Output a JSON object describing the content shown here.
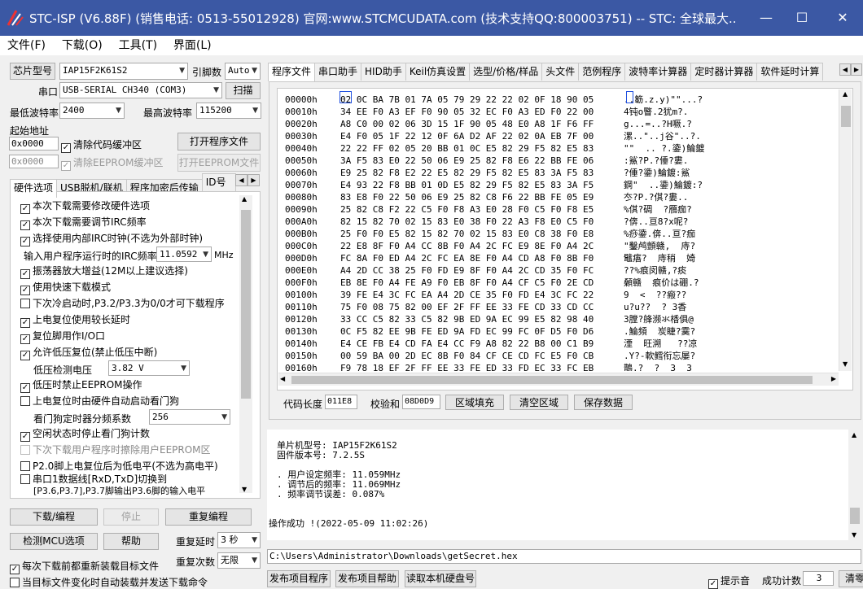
{
  "window": {
    "title": "STC-ISP (V6.88F) (销售电话: 0513-55012928) 官网:www.STCMCUDATA.com (技术支持QQ:800003751) -- STC: 全球最大...",
    "min_glyph": "—",
    "max_glyph": "☐",
    "close_glyph": "✕"
  },
  "menu": [
    "文件(F)",
    "下载(O)",
    "工具(T)",
    "界面(L)"
  ],
  "left": {
    "chip_btn": "芯片型号",
    "chip_value": "IAP15F2K61S2",
    "pins_label": "引脚数",
    "pins_value": "Auto",
    "port_label": "串口",
    "port_value": "USB-SERIAL CH340 (COM3)",
    "scan_btn": "扫描",
    "min_baud_label": "最低波特率",
    "min_baud_value": "2400",
    "max_baud_label": "最高波特率",
    "max_baud_value": "115200",
    "start_addr_label": "起始地址",
    "addr1_value": "0x0000",
    "clear_code_label": "清除代码缓冲区",
    "open_prog_btn": "打开程序文件",
    "addr2_value": "0x0000",
    "clear_eeprom_label": "清除EEPROM缓冲区",
    "open_eeprom_btn": "打开EEPROM文件",
    "tabs": [
      "硬件选项",
      "USB脱机/联机",
      "程序加密后传输",
      "ID号"
    ],
    "hw_options": [
      {
        "label": "本次下载需要修改硬件选项",
        "checked": true
      },
      {
        "label": "本次下载需要调节IRC频率",
        "checked": true
      },
      {
        "label": "选择使用内部IRC时钟(不选为外部时钟)",
        "checked": true
      },
      {
        "label": "振荡器放大增益(12M以上建议选择)",
        "checked": true
      },
      {
        "label": "使用快速下载模式",
        "checked": true
      },
      {
        "label": "下次冷启动时,P3.2/P3.3为0/0才可下载程序",
        "checked": false
      },
      {
        "label": "上电复位使用较长延时",
        "checked": true
      },
      {
        "label": "复位脚用作I/O口",
        "checked": true
      },
      {
        "label": "允许低压复位(禁止低压中断)",
        "checked": true
      },
      {
        "label": "低压时禁止EEPROM操作",
        "checked": true
      },
      {
        "label": "上电复位时由硬件自动启动看门狗",
        "checked": false
      },
      {
        "label": "空闲状态时停止看门狗计数",
        "checked": true
      },
      {
        "label": "下次下载用户程序时擦除用户EEPROM区",
        "checked": false
      },
      {
        "label": "P2.0脚上电复位后为低电平(不选为高电平)",
        "checked": false
      },
      {
        "label": "串口1数据线[RxD,TxD]切换到",
        "checked": false
      }
    ],
    "irc_freq_label": "输入用户程序运行时的IRC频率",
    "irc_freq_value": "11.0592",
    "irc_unit": "MHz",
    "lv_label": "低压检测电压",
    "lv_value": "3.82 V",
    "wdt_label": "看门狗定时器分频系数",
    "wdt_value": "256",
    "uart_line2": "[P3.6,P3.7],P3.7脚输出P3.6脚的输入电平",
    "download_btn": "下载/编程",
    "stop_btn": "停止",
    "reprogram_btn": "重复编程",
    "detect_btn": "检测MCU选项",
    "help_btn": "帮助",
    "repeat_delay_label": "重复延时",
    "repeat_delay_value": "3 秒",
    "reload_label": "每次下载前都重新装载目标文件",
    "reload_checked": true,
    "repeat_count_label": "重复次数",
    "repeat_count_value": "无限",
    "auto_label": "当目标文件变化时自动装载并发送下载命令",
    "auto_checked": false
  },
  "right": {
    "tabs": [
      "程序文件",
      "串口助手",
      "HID助手",
      "Keil仿真设置",
      "选型/价格/样品",
      "头文件",
      "范例程序",
      "波特率计算器",
      "定时器计算器",
      "软件延时计算"
    ],
    "hex_rows": [
      {
        "addr": "00000h",
        "hex": "02 0C BA 7B 01 7A 05 79 29 22 22 02 0F 18 90 05",
        "ascii": "..簕.z.y)\"\"...?"
      },
      {
        "addr": "00010h",
        "hex": "34 EE F0 A3 EF F0 90 05 32 EC F0 A3 ED F0 22 00",
        "ascii": "4钝o睯.2犹m?."
      },
      {
        "addr": "00020h",
        "hex": "A8 C0 00 02 06 3D 15 1F 90 05 48 E0 A8 1F F6 FF",
        "ascii": "g...=..?H噘.?"
      },
      {
        "addr": "00030h",
        "hex": "E4 F0 05 1F 22 12 0F 6A D2 AF 22 02 0A EB 7F 00",
        "ascii": "漯..\"..j谷\"..?."
      },
      {
        "addr": "00040h",
        "hex": "22 22 FF 02 05 20 BB 01 0C E5 82 29 F5 82 E5 83",
        "ascii": "\"\"  .. ?.鍌)鯩鍍"
      },
      {
        "addr": "00050h",
        "hex": "3A F5 83 E0 22 50 06 E9 25 82 F8 E6 22 BB FE 06",
        "ascii": ":鯊?P.?倕?婁."
      },
      {
        "addr": "00060h",
        "hex": "E9 25 82 F8 E2 22 E5 82 29 F5 82 E5 83 3A F5 83",
        "ascii": "?倕?鍌)鯩鍍:鯊"
      },
      {
        "addr": "00070h",
        "hex": "E4 93 22 F8 BB 01 0D E5 82 29 F5 82 E5 83 3A F5",
        "ascii": "鋼\"  ..鍌)鯩鍍:?"
      },
      {
        "addr": "00080h",
        "hex": "83 E8 F0 22 50 06 E9 25 82 C8 F6 22 BB FE 05 E9",
        "ascii": "冭?P.?倛?婁.."
      },
      {
        "addr": "00090h",
        "hex": "25 82 C8 F2 22 C5 F0 F8 A3 E0 28 F0 C5 F0 F8 E5",
        "ascii": "%倛?碉  ?鴈痂?"
      },
      {
        "addr": "000A0h",
        "hex": "82 15 82 70 02 15 83 E0 38 F0 22 A3 F8 E0 C5 F0",
        "ascii": "?倴..亘8?x呢?"
      },
      {
        "addr": "000B0h",
        "hex": "25 F0 F0 E5 82 15 82 70 02 15 83 E0 C8 38 F0 E8",
        "ascii": "%痧鍌.倴..亘?痂"
      },
      {
        "addr": "000C0h",
        "hex": "22 E8 8F F0 A4 CC 8B F0 A4 2C FC E9 8E F0 A4 2C",
        "ascii": "\"鑿鸬顫赣,  庤?"
      },
      {
        "addr": "000D0h",
        "hex": "FC 8A F0 ED A4 2C FC EA 8E F0 A4 CD A8 F0 8B F0",
        "ascii": "鼊痦?  庤稍  婍"
      },
      {
        "addr": "000E0h",
        "hex": "A4 2D CC 38 25 F0 FD E9 8F F0 A4 2C CD 35 F0 FC",
        "ascii": "??%痕闵赣,?痰"
      },
      {
        "addr": "000F0h",
        "hex": "EB 8E F0 A4 FE A9 F0 EB 8F F0 A4 CF C5 F0 2E CD",
        "ascii": "顙赣  痕价は硼.?"
      },
      {
        "addr": "00100h",
        "hex": "39 FE E4 3C FC EA A4 2D CE 35 F0 FD E4 3C FC 22",
        "ascii": "9  <  ??瘢??"
      },
      {
        "addr": "00110h",
        "hex": "75 F0 08 75 82 00 EF 2F FF EE 33 FE CD 33 CD CC",
        "ascii": "u?u??  ? 3香"
      },
      {
        "addr": "00120h",
        "hex": "33 CC C5 82 33 C5 82 9B ED 9A EC 99 E5 82 98 40",
        "ascii": "3膛?艂濒氺楿俱@"
      },
      {
        "addr": "00130h",
        "hex": "0C F5 82 EE 9B FE ED 9A FD EC 99 FC 0F D5 F0 D6",
        "ascii": ".鯩頻  炭睫?霙?"
      },
      {
        "addr": "00140h",
        "hex": "E4 CE FB E4 CD FA E4 CC F9 A8 82 22 B8 00 C1 B9",
        "ascii": "湮  旺溯   ??凉"
      },
      {
        "addr": "00150h",
        "hex": "00 59 BA 00 2D EC 8B F0 84 CF CE CD FC E5 F0 CB",
        "ascii": ".Y?-軟鳕衔忘屡?"
      },
      {
        "addr": "00160h",
        "hex": "F9 78 18 EF 2F FF EE 33 FE ED 33 FD EC 33 FC EB",
        "ascii": "鵲.?  ?  3  3"
      }
    ],
    "code_len_label": "代码长度",
    "code_len_value": "011E8",
    "checksum_label": "校验和",
    "checksum_value": "08D0D9",
    "fill_btn": "区域填充",
    "clear_btn": "清空区域",
    "save_btn": "保存数据",
    "info_lines": [
      "单片机型号: IAP15F2K61S2",
      "固件版本号: 7.2.5S",
      "",
      ". 用户设定频率: 11.059MHz",
      ". 调节后的频率: 11.069MHz",
      ". 频率调节误差: 0.087%",
      "",
      "",
      "操作成功 !(2022-05-09 11:02:26)"
    ],
    "path": "C:\\Users\\Administrator\\Downloads\\getSecret.hex",
    "publish_btn": "发布项目程序",
    "publish_help_btn": "发布项目帮助",
    "read_disk_btn": "读取本机硬盘号",
    "beep_label": "提示音",
    "beep_checked": true,
    "success_label": "成功计数",
    "success_value": "3",
    "clear_count_btn": "清零"
  }
}
